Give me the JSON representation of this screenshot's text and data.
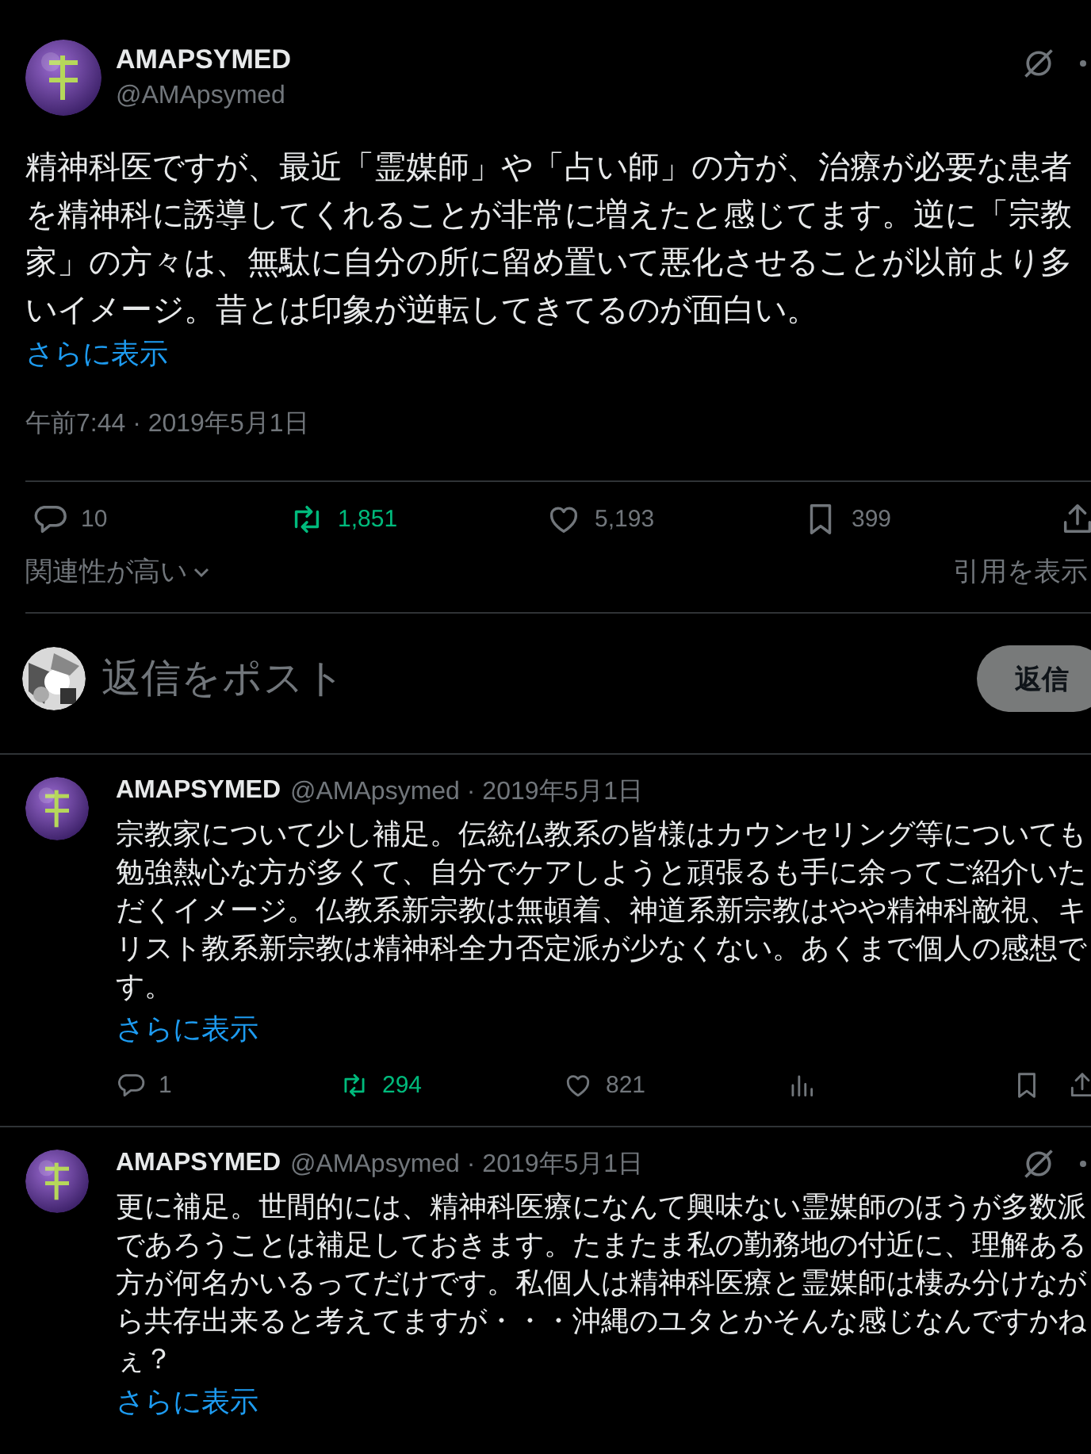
{
  "post": {
    "author": {
      "name": "AMAPSYMED",
      "handle": "@AMApsymed"
    },
    "text": "精神科医ですが、最近「霊媒師」や「占い師」の方が、治療が必要な患者を精神科に誘導してくれることが非常に増えたと感じてます。逆に「宗教家」の方々は、無駄に自分の所に留め置いて悪化させることが以前より多いイメージ。昔とは印象が逆転してきてるのが面白い。",
    "show_more": "さらに表示",
    "timestamp": "午前7:44 · 2019年5月1日",
    "stats": [
      {
        "kind": "reply",
        "count": "10",
        "active": false
      },
      {
        "kind": "repost",
        "count": "1,851",
        "active": true
      },
      {
        "kind": "like",
        "count": "5,193",
        "active": false
      },
      {
        "kind": "bookmark",
        "count": "399",
        "active": false
      },
      {
        "kind": "share",
        "active": false
      }
    ],
    "sort_label": "関連性が高い",
    "quotes_link": "引用を表示"
  },
  "composer": {
    "placeholder": "返信をポスト",
    "button": "返信"
  },
  "replies": [
    {
      "name": "AMAPSYMED",
      "handle": "@AMApsymed · 2019年5月1日",
      "text": "宗教家について少し補足。伝統仏教系の皆様はカウンセリング等についても勉強熱心な方が多くて、自分でケアしようと頑張るも手に余ってご紹介いただくイメージ。仏教系新宗教は無頓着、神道系新宗教はやや精神科敵視、キリスト教系新宗教は精神科全力否定派が少なくない。あくまで個人の感想です。",
      "show_more": "さらに表示",
      "stats": [
        {
          "kind": "reply",
          "count": "1",
          "active": false
        },
        {
          "kind": "repost",
          "count": "294",
          "active": true
        },
        {
          "kind": "like",
          "count": "821",
          "active": false
        },
        {
          "kind": "views",
          "active": false
        },
        {
          "kind": "bookmark",
          "active": false
        },
        {
          "kind": "share",
          "active": false
        }
      ]
    },
    {
      "name": "AMAPSYMED",
      "handle": "@AMApsymed · 2019年5月1日",
      "text": "更に補足。世間的には、精神科医療になんて興味ない霊媒師のほうが多数派であろうことは補足しておきます。たまたま私の勤務地の付近に、理解ある方が何名かいるってだけです。私個人は精神科医療と霊媒師は棲み分けながら共存出来ると考えてますが・・・沖縄のユタとかそんな感じなんですかねぇ？",
      "show_more": "さらに表示"
    }
  ]
}
